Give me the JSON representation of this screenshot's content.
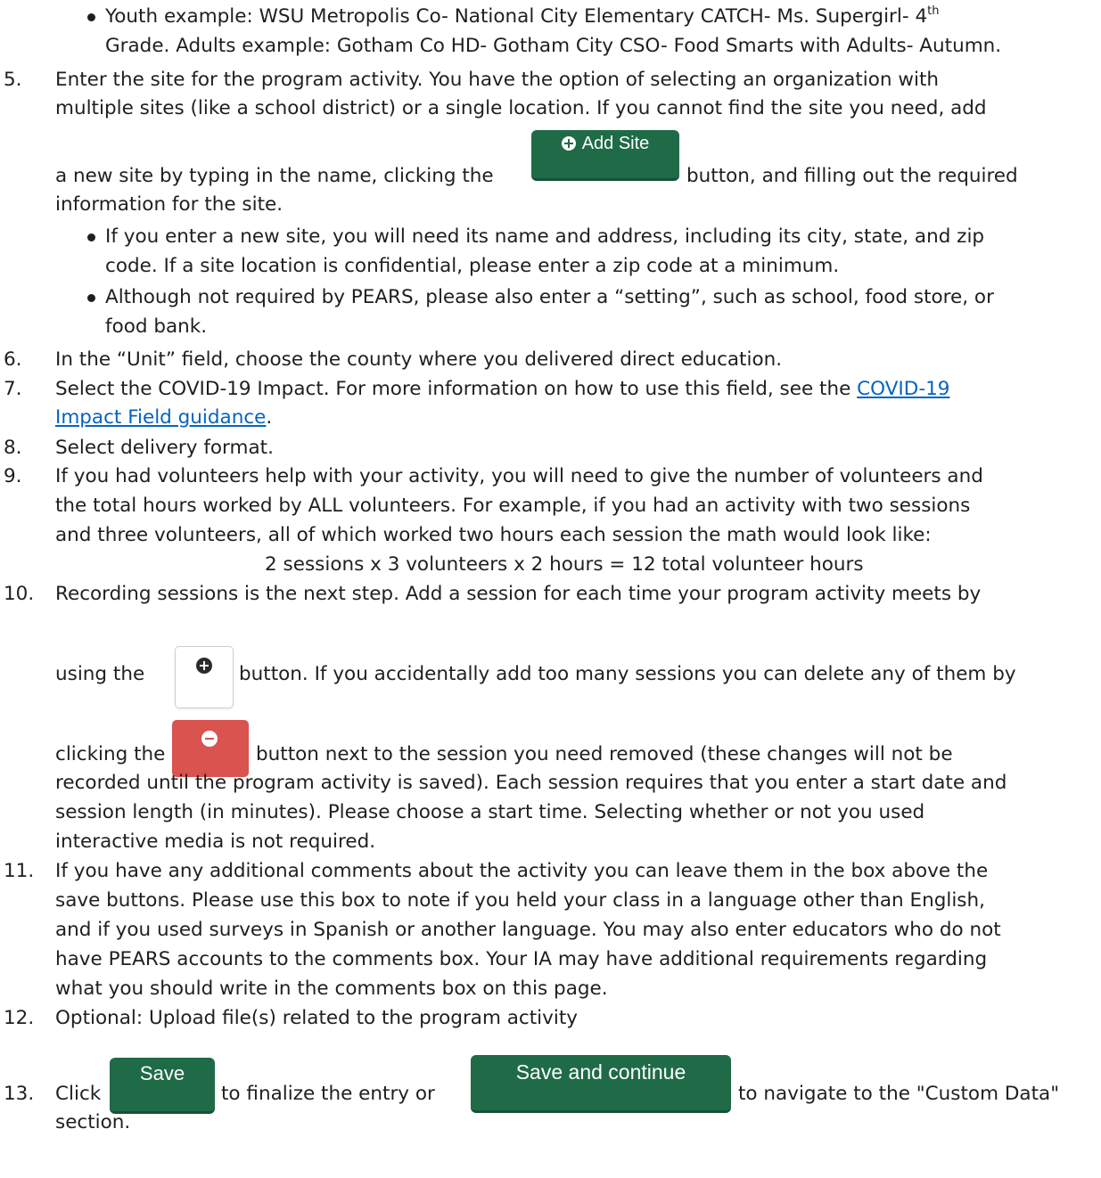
{
  "step4": {
    "bullet1_line1": "Youth example: WSU Metropolis Co- National City Elementary CATCH- Ms. Supergirl- 4",
    "bullet1_sup": "th",
    "bullet1_line2": "Grade. Adults example: Gotham Co HD- Gotham City CSO- Food Smarts with Adults- Autumn."
  },
  "step5": {
    "number": "5.",
    "line1": "Enter the site for the program activity.  You have the option of selecting an organization with",
    "line2": "multiple sites (like a school district) or a single location.  If you cannot find the site you need, add",
    "line3_before": "a new site by typing in the name, clicking the",
    "add_site_label": "Add Site",
    "line3_after": "button, and filling out the required",
    "line4": "information for the site.",
    "bullet1_line1": "If you enter a new site, you will need its name and address, including its city, state, and zip",
    "bullet1_line2": "code. If a site location is confidential, please enter a zip code at a minimum.",
    "bullet2_line1": "Although not required by PEARS, please also enter a “setting”, such as school, food store, or",
    "bullet2_line2": "food bank."
  },
  "step6": {
    "number": "6.",
    "text": "In the “Unit” field, choose the county where you delivered direct education."
  },
  "step7": {
    "number": "7.",
    "text_before": "Select the COVID-19 Impact. For more information on how to use this field, see the",
    "link_part1": "COVID-19",
    "link_part2": "Impact Field guidance",
    "text_after": "."
  },
  "step8": {
    "number": "8.",
    "text": "Select delivery format."
  },
  "step9": {
    "number": "9.",
    "line1": "If you had volunteers help with your activity, you will need to give the number of volunteers and",
    "line2": "the total hours worked by ALL volunteers.  For example, if you had an activity with two sessions",
    "line3": "and three volunteers, all of which worked two hours each session the math would look like:",
    "formula": "2 sessions x 3 volunteers x 2 hours = 12 total volunteer hours"
  },
  "step10": {
    "number": "10.",
    "line1": "Recording sessions is the next step. Add a session for each time your program activity meets by",
    "line2_before": "using the",
    "line2_after": "button.  If you accidentally add too many sessions you can delete any of them by",
    "line3_before": "clicking the",
    "line3_after": "button next to the session you need removed (these changes will not be",
    "line4": "recorded until the program activity is saved). Each session requires that you enter a start date and",
    "line5": "session length (in minutes).  Please choose a start time. Selecting whether or not you used",
    "line6": "interactive media is not required."
  },
  "step11": {
    "number": "11.",
    "line1": "If you have any additional comments about the activity you can leave them in the box above the",
    "line2": "save buttons. Please use this box to note if you held your class in a language other than English,",
    "line3": "and if you used surveys in Spanish or another language. You may also enter educators who do not",
    "line4": "have PEARS accounts to the comments box. Your IA may have additional requirements regarding",
    "line5": "what you should write in the comments box on this page."
  },
  "step12": {
    "number": "12.",
    "text": "Optional: Upload file(s) related to the program activity"
  },
  "step13": {
    "number": "13.",
    "click": "Click",
    "save_label": "Save",
    "middle": "to finalize the entry or",
    "save_continue_label": "Save and continue",
    "after": "to navigate to the \"Custom Data\"",
    "line2": "section."
  },
  "colors": {
    "button_green": "#1f6b47",
    "button_red": "#d9534f",
    "link": "#0563c1"
  },
  "icons": [
    "plus-circle-icon",
    "minus-circle-icon",
    "bullet-icon"
  ]
}
